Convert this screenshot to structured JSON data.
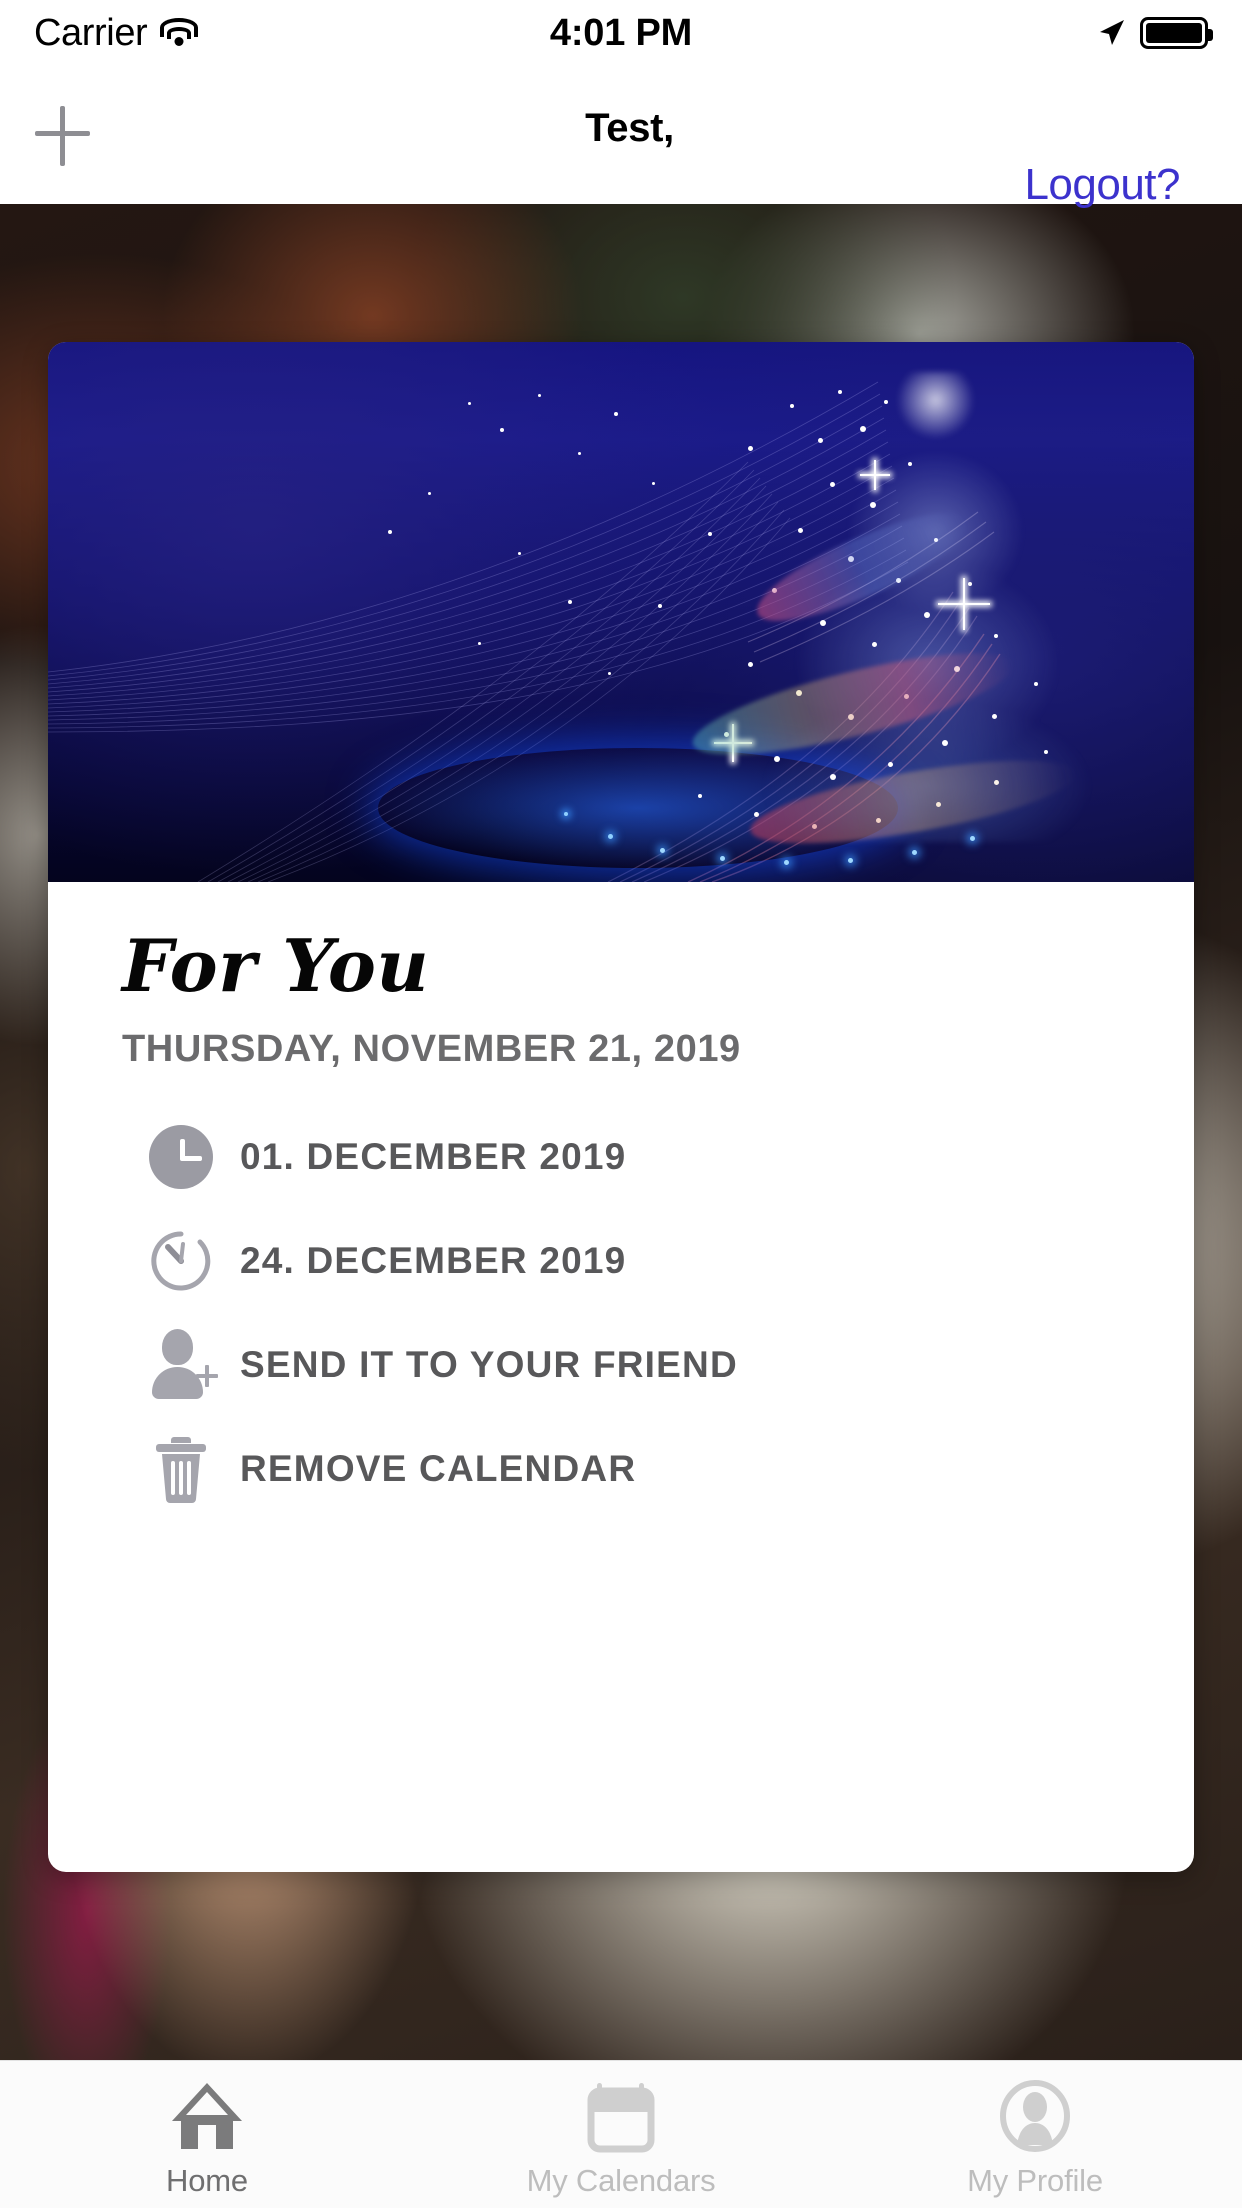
{
  "status_bar": {
    "carrier": "Carrier",
    "time": "4:01 PM",
    "wifi_icon": "wifi-icon",
    "location_icon": "location-arrow-icon",
    "battery_icon": "battery-full-icon"
  },
  "nav_bar": {
    "add_icon": "plus-icon",
    "title": "Test,",
    "logout_label": "Logout?",
    "logout_color": "#3c32cd"
  },
  "card": {
    "hero_image_alt": "christmas-tree-sparkle-image",
    "title": "For You",
    "date": "THURSDAY, NOVEMBER 21, 2019",
    "items": [
      {
        "icon": "clock-filled-icon",
        "label": "01. DECEMBER 2019"
      },
      {
        "icon": "timer-outline-icon",
        "label": "24. DECEMBER 2019"
      },
      {
        "icon": "person-add-icon",
        "label": "SEND IT TO YOUR FRIEND"
      },
      {
        "icon": "trash-icon",
        "label": "REMOVE CALENDAR"
      }
    ]
  },
  "tab_bar": {
    "tabs": [
      {
        "icon": "home-icon",
        "label": "Home",
        "active": true
      },
      {
        "icon": "calendar-icon",
        "label": "My Calendars",
        "active": false
      },
      {
        "icon": "profile-icon",
        "label": "My Profile",
        "active": false
      }
    ]
  },
  "colors": {
    "accent_link": "#3c32cd",
    "muted_text": "#6b6b6d",
    "row_text": "#58585a",
    "icon_gray": "#a5a5ad",
    "tab_active": "#6f6f70",
    "tab_inactive": "#bdbdbd",
    "card_bg": "#ffffff",
    "hero_blue": "#151480"
  }
}
